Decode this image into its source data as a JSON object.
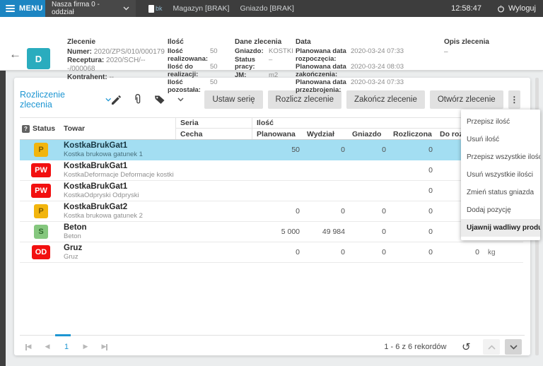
{
  "topbar": {
    "menu_label": "MENU",
    "company": "Nasza firma 0 - oddział",
    "device_label": "bk",
    "magazyn": "Magazyn [BRAK]",
    "gniazdo": "Gniazdo [BRAK]",
    "time": "12:58:47",
    "logout_label": "Wyloguj"
  },
  "header": {
    "avatar_letter": "D",
    "order": {
      "title": "Zlecenie",
      "numer_label": "Numer:",
      "numer": "2020/ZPS/010/000179",
      "receptura_label": "Receptura:",
      "receptura": "2020/SCH/---/000068",
      "kontrahent_label": "Kontrahent:",
      "kontrahent": "--"
    },
    "ilosc": {
      "title": "Ilość",
      "rows": [
        {
          "label": "Ilość realizowana:",
          "value": "50"
        },
        {
          "label": "Ilość do realizacji:",
          "value": "50"
        },
        {
          "label": "Ilość pozostała:",
          "value": "50"
        }
      ]
    },
    "dane": {
      "title": "Dane zlecenia",
      "rows": [
        {
          "label": "Gniazdo:",
          "value": "KOSTKI"
        },
        {
          "label": "Status pracy:",
          "value": "–"
        },
        {
          "label": "JM:",
          "value": "m2"
        }
      ]
    },
    "data": {
      "title": "Data",
      "rows": [
        {
          "label": "Planowana data rozpoczęcia:",
          "value": "2020-03-24 07:33"
        },
        {
          "label": "Planowana data zakończenia:",
          "value": "2020-03-24 08:03"
        },
        {
          "label": "Planowana data przezbrojenia:",
          "value": "2020-03-24 07:33"
        }
      ]
    },
    "opis": {
      "title": "Opis zlecenia",
      "value": "–"
    }
  },
  "toolbar": {
    "view_selector": "Rozliczenie zlecenia",
    "buttons": [
      "Ustaw serię",
      "Rozlicz zlecenie",
      "Zakończ zlecenie",
      "Otwórz zlecenie"
    ],
    "more_glyph": "⋮"
  },
  "context_menu": {
    "items": [
      "Przepisz ilość",
      "Usuń ilość",
      "Przepisz wszystkie ilości",
      "Usuń wszystkie ilości",
      "Zmień status gniazda",
      "Dodaj pozycję",
      "Ujawnij wadliwy produkt"
    ],
    "highlighted": "Ujawnij wadliwy produkt"
  },
  "table": {
    "status_header": "Status",
    "towar_header": "Towar",
    "seria_header": "Seria",
    "cecha_header": "Cecha",
    "ilosc_group_header": "Ilość",
    "sub_headers": [
      "Planowana",
      "Wydział",
      "Gniazdo",
      "Rozliczona",
      "Do rozliczenia"
    ],
    "rows": [
      {
        "status": "P",
        "status_color": "amber",
        "name": "KostkaBrukGat1",
        "desc": "Kostka brukowa gatunek 1",
        "planowana": "50",
        "wydzial": "0",
        "gniazdo": "0",
        "rozliczona": "0",
        "do_rozliczenia": "",
        "unit": "",
        "selected": true
      },
      {
        "status": "PW",
        "status_color": "red",
        "name": "KostkaBrukGat1",
        "desc": "KostkaDeformacje Deformacje kostki",
        "planowana": "",
        "wydzial": "",
        "gniazdo": "",
        "rozliczona": "0",
        "do_rozliczenia": "",
        "unit": "",
        "selected": false
      },
      {
        "status": "PW",
        "status_color": "red",
        "name": "KostkaBrukGat1",
        "desc": "KostkaOdpryski Odpryski",
        "planowana": "",
        "wydzial": "",
        "gniazdo": "",
        "rozliczona": "0",
        "do_rozliczenia": "",
        "unit": "",
        "selected": false
      },
      {
        "status": "P",
        "status_color": "amber",
        "name": "KostkaBrukGat2",
        "desc": "Kostka brukowa gatunek 2",
        "planowana": "0",
        "wydzial": "0",
        "gniazdo": "0",
        "rozliczona": "0",
        "do_rozliczenia": "",
        "unit": "",
        "selected": false
      },
      {
        "status": "S",
        "status_color": "green",
        "name": "Beton",
        "desc": "Beton",
        "planowana": "5 000",
        "wydzial": "49 984",
        "gniazdo": "0",
        "rozliczona": "0",
        "do_rozliczenia": "",
        "unit": "",
        "selected": false
      },
      {
        "status": "OD",
        "status_color": "red",
        "name": "Gruz",
        "desc": "Gruz",
        "planowana": "0",
        "wydzial": "0",
        "gniazdo": "0",
        "rozliczona": "0",
        "do_rozliczenia": "0",
        "unit": "kg",
        "selected": false
      }
    ]
  },
  "pagination": {
    "current_page": "1",
    "records_label": "1 - 6 z 6 rekordów",
    "refresh_glyph": "↻"
  },
  "colors": {
    "accent_blue": "#1e96d2",
    "topbar_blue": "#1c85c2",
    "topbar_dark": "#3d3d3d",
    "avatar_teal": "#2aacbe",
    "selected_row": "#a3def2",
    "badge_amber": "#f2b50d",
    "badge_red": "#f21010",
    "badge_green": "#85c77e"
  }
}
